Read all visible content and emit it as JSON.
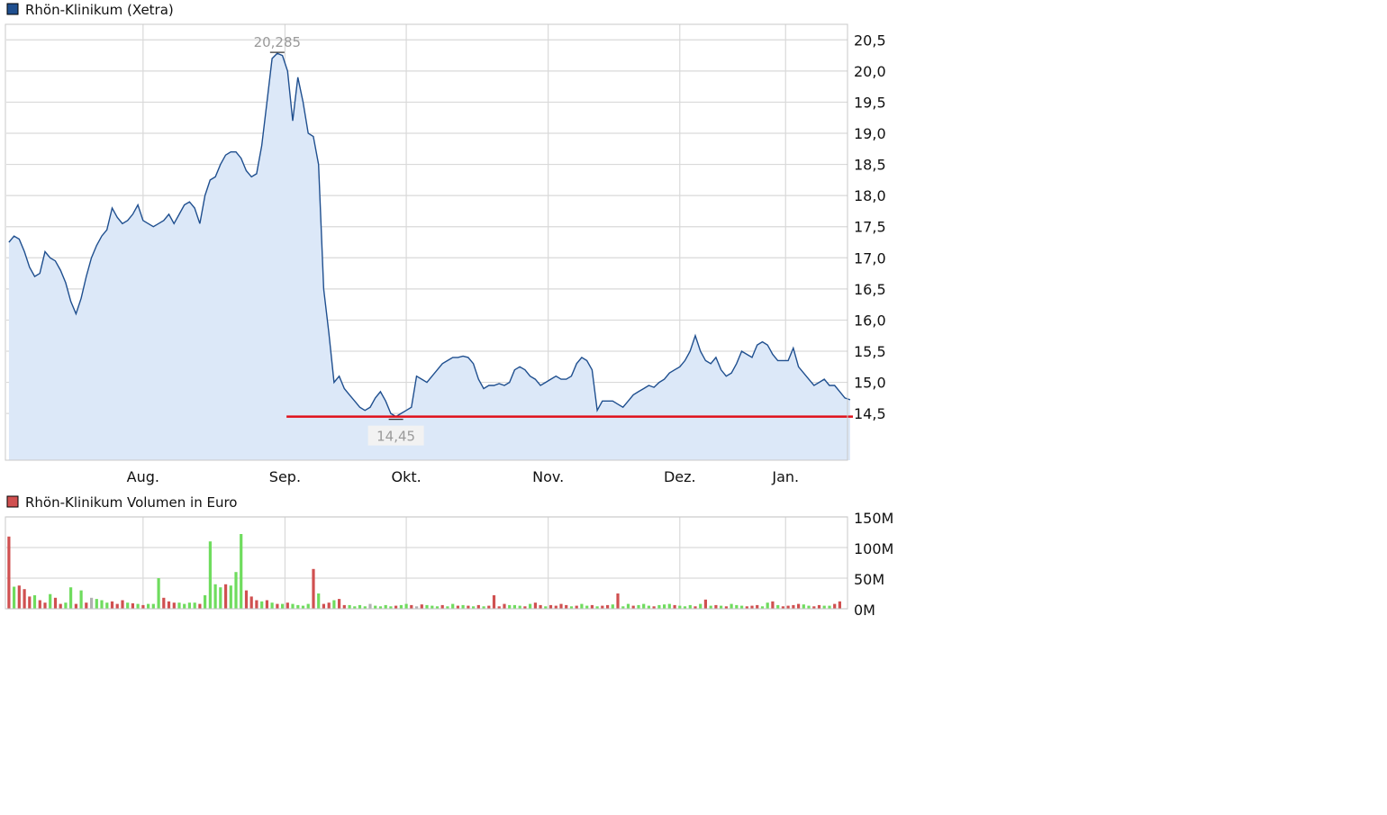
{
  "colors": {
    "price_line": "#1f4f8f",
    "price_fill": "#dce8f8",
    "support_line": "#e0101a",
    "vol_up": "#6fdc5e",
    "vol_down": "#d05050",
    "vol_neutral": "#b0b0b0",
    "grid": "#d9d9d9",
    "legend_price": "#1f4f8f",
    "legend_volume": "#d05050",
    "annotation": "#9a9a9a"
  },
  "chart_data": [
    {
      "type": "area",
      "title": "Rhön-Klinikum (Xetra)",
      "x_tick_labels": [
        "Aug.",
        "Sep.",
        "Okt.",
        "Nov.",
        "Dez.",
        "Jan."
      ],
      "y_tick_labels": [
        "20,5",
        "20,0",
        "19,5",
        "19,0",
        "18,5",
        "18,0",
        "17,5",
        "17,0",
        "16,5",
        "16,0",
        "15,5",
        "15,0",
        "14,5"
      ],
      "y_ticks": [
        20.5,
        20.0,
        19.5,
        19.0,
        18.5,
        18.0,
        17.5,
        17.0,
        16.5,
        16.0,
        15.5,
        15.0,
        14.5
      ],
      "ylim": [
        13.75,
        20.75
      ],
      "xlim": [
        0,
        163
      ],
      "x_tick_positions": [
        26,
        53.5,
        77,
        104.5,
        130,
        150.5
      ],
      "annotation_max": {
        "label": "20,285",
        "value": 20.285
      },
      "annotation_min": {
        "label": "14,45",
        "value": 14.45
      },
      "support_level": 14.45,
      "values": [
        17.25,
        17.35,
        17.3,
        17.1,
        16.85,
        16.7,
        16.75,
        17.1,
        17.0,
        16.95,
        16.8,
        16.6,
        16.3,
        16.1,
        16.35,
        16.7,
        17.0,
        17.2,
        17.35,
        17.45,
        17.8,
        17.65,
        17.55,
        17.6,
        17.7,
        17.85,
        17.6,
        17.55,
        17.5,
        17.55,
        17.6,
        17.7,
        17.55,
        17.7,
        17.85,
        17.9,
        17.8,
        17.55,
        18.0,
        18.25,
        18.3,
        18.5,
        18.65,
        18.7,
        18.7,
        18.6,
        18.4,
        18.3,
        18.35,
        18.8,
        19.5,
        20.2,
        20.285,
        20.25,
        20.0,
        19.2,
        19.9,
        19.5,
        19.0,
        18.95,
        18.5,
        16.5,
        15.8,
        15.0,
        15.1,
        14.9,
        14.8,
        14.7,
        14.6,
        14.55,
        14.6,
        14.75,
        14.85,
        14.7,
        14.5,
        14.45,
        14.5,
        14.55,
        14.6,
        15.1,
        15.05,
        15.0,
        15.1,
        15.2,
        15.3,
        15.35,
        15.4,
        15.4,
        15.42,
        15.4,
        15.3,
        15.05,
        14.9,
        14.95,
        14.95,
        14.98,
        14.95,
        15.0,
        15.2,
        15.25,
        15.2,
        15.1,
        15.05,
        14.95,
        15.0,
        15.05,
        15.1,
        15.05,
        15.05,
        15.1,
        15.3,
        15.4,
        15.35,
        15.2,
        14.55,
        14.7,
        14.7,
        14.7,
        14.65,
        14.6,
        14.7,
        14.8,
        14.85,
        14.9,
        14.95,
        14.92,
        15.0,
        15.05,
        15.15,
        15.2,
        15.25,
        15.35,
        15.5,
        15.75,
        15.5,
        15.35,
        15.3,
        15.4,
        15.2,
        15.1,
        15.15,
        15.3,
        15.5,
        15.45,
        15.4,
        15.6,
        15.65,
        15.6,
        15.45,
        15.35,
        15.35,
        15.35,
        15.55,
        15.25,
        15.15,
        15.05,
        14.95,
        15.0,
        15.05,
        14.95,
        14.95,
        14.85,
        14.75,
        14.72
      ]
    },
    {
      "type": "bar",
      "title": "Rhön-Klinikum Volumen in Euro",
      "y_tick_labels": [
        "150M",
        "100M",
        "50M",
        "0M"
      ],
      "y_ticks": [
        150,
        100,
        50,
        0
      ],
      "ylim": [
        0,
        150
      ],
      "xlim": [
        0,
        163
      ],
      "x_tick_positions": [
        26,
        53.5,
        77,
        104.5,
        130,
        150.5
      ],
      "directions": [
        "d",
        "u",
        "d",
        "d",
        "d",
        "u",
        "d",
        "d",
        "u",
        "d",
        "d",
        "u",
        "u",
        "d",
        "u",
        "d",
        "n",
        "u",
        "u",
        "u",
        "d",
        "d",
        "d",
        "u",
        "d",
        "u",
        "d",
        "u",
        "u",
        "u",
        "d",
        "d",
        "d",
        "u",
        "u",
        "u",
        "u",
        "d",
        "u",
        "u",
        "u",
        "u",
        "d",
        "u",
        "u",
        "u",
        "d",
        "d",
        "d",
        "u",
        "d",
        "u",
        "d",
        "u",
        "d",
        "u",
        "u",
        "u",
        "u",
        "d",
        "u",
        "d",
        "d",
        "u",
        "d",
        "d",
        "u",
        "u",
        "u",
        "u",
        "n",
        "u",
        "u",
        "u",
        "u",
        "d",
        "u",
        "u",
        "d",
        "n",
        "d",
        "u",
        "u",
        "u",
        "d",
        "u",
        "u",
        "d",
        "u",
        "d",
        "u",
        "d",
        "u",
        "d",
        "d",
        "d",
        "d",
        "u",
        "u",
        "u",
        "d",
        "u",
        "d",
        "d",
        "u",
        "d",
        "d",
        "d",
        "d",
        "u",
        "d",
        "u",
        "u",
        "d",
        "u",
        "d",
        "d",
        "u",
        "d",
        "u",
        "u",
        "d",
        "u",
        "u",
        "u",
        "d",
        "u",
        "u",
        "u",
        "d",
        "u",
        "u",
        "u",
        "d",
        "u",
        "d",
        "u",
        "d",
        "u",
        "d",
        "u",
        "u",
        "u",
        "d",
        "d",
        "d",
        "u",
        "u",
        "d",
        "u",
        "d",
        "d",
        "d",
        "d",
        "u",
        "u",
        "d",
        "d",
        "u",
        "u",
        "d",
        "d",
        "d",
        "u"
      ],
      "values": [
        118,
        36,
        38,
        32,
        20,
        22,
        14,
        10,
        24,
        18,
        8,
        10,
        35,
        8,
        30,
        10,
        18,
        16,
        14,
        10,
        12,
        8,
        14,
        10,
        9,
        8,
        6,
        8,
        8,
        50,
        18,
        12,
        10,
        10,
        8,
        10,
        10,
        8,
        22,
        110,
        40,
        35,
        40,
        38,
        60,
        122,
        30,
        20,
        14,
        12,
        14,
        10,
        8,
        8,
        10,
        8,
        6,
        5,
        8,
        65,
        25,
        8,
        10,
        14,
        16,
        6,
        6,
        4,
        6,
        4,
        8,
        5,
        4,
        6,
        4,
        5,
        6,
        8,
        6,
        4,
        7,
        6,
        5,
        4,
        6,
        4,
        8,
        5,
        6,
        5,
        4,
        6,
        4,
        5,
        22,
        4,
        8,
        6,
        6,
        5,
        4,
        8,
        10,
        6,
        4,
        6,
        5,
        8,
        6,
        4,
        5,
        8,
        5,
        6,
        4,
        5,
        6,
        7,
        25,
        4,
        8,
        5,
        6,
        8,
        5,
        4,
        6,
        7,
        8,
        6,
        5,
        4,
        6,
        4,
        8,
        15,
        5,
        6,
        5,
        4,
        8,
        6,
        5,
        4,
        5,
        6,
        4,
        10,
        12,
        6,
        4,
        5,
        6,
        8,
        7,
        5,
        4,
        6,
        5,
        5,
        8,
        12
      ]
    }
  ]
}
